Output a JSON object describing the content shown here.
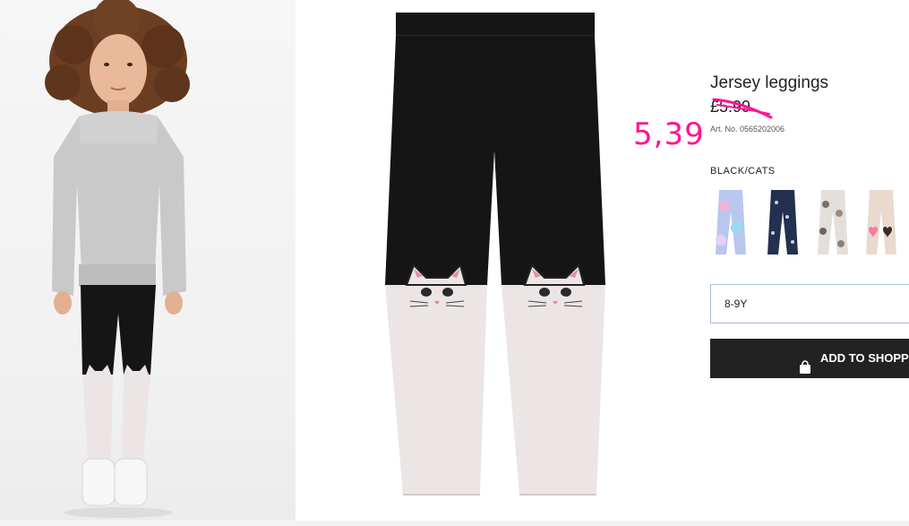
{
  "product": {
    "title": "Jersey leggings",
    "old_price": "£5.99",
    "sale_price": "5,39",
    "art_no": "Art. No. 0565202006",
    "color_name": "BLACK/CATS",
    "size_value": "8-9Y",
    "add_to_bag_label": "ADD TO SHOPPI"
  },
  "swatches": [
    {
      "name": "tie-dye",
      "color": "#b9c7ef"
    },
    {
      "name": "navy-print",
      "color": "#23304f"
    },
    {
      "name": "floral-grey",
      "color": "#d8d0cb"
    },
    {
      "name": "beige-heart",
      "color": "#e9d9cf"
    }
  ],
  "colors": {
    "sale": "#ff1493",
    "button": "#222222",
    "legging_black": "#151515",
    "legging_light": "#ebe6e5"
  }
}
